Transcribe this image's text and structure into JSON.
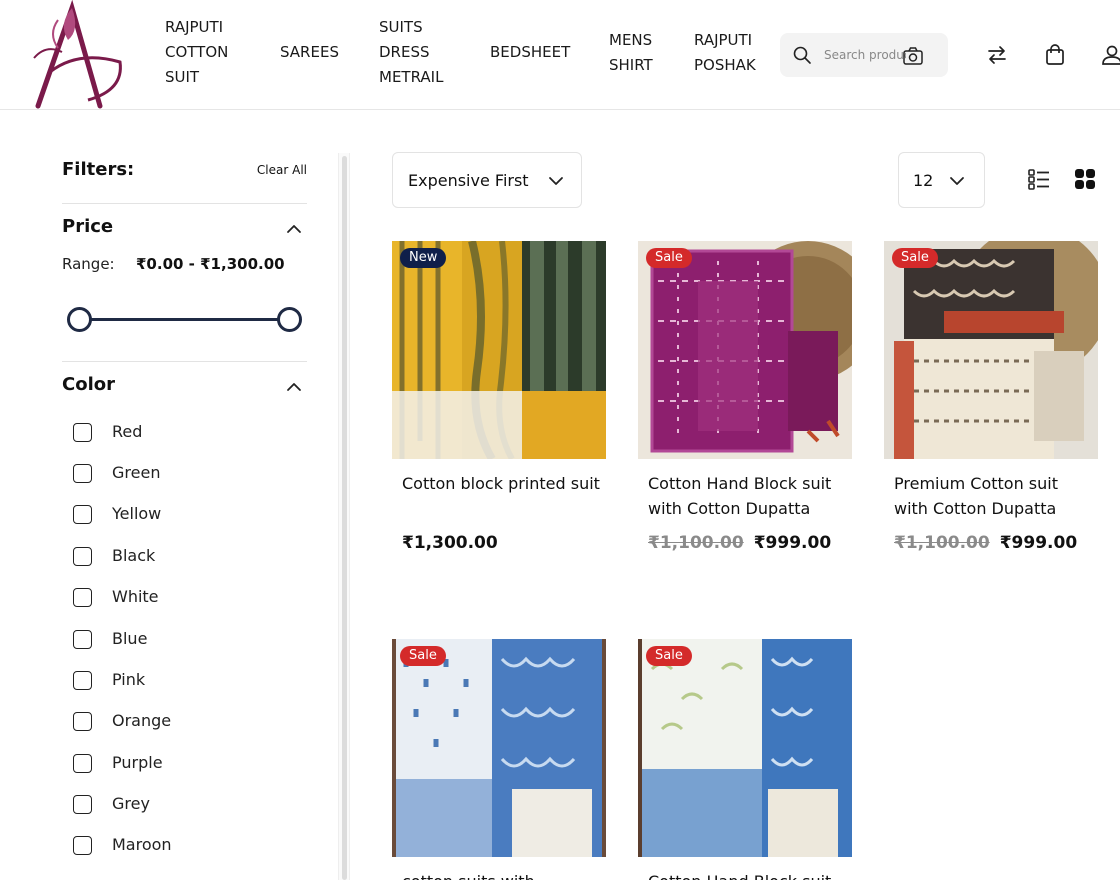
{
  "header": {
    "nav": [
      {
        "label": "RAJPUTI COTTON SUIT"
      },
      {
        "label": "SAREES"
      },
      {
        "label": "SUITS DRESS METRAIL"
      },
      {
        "label": "BEDSHEET"
      },
      {
        "label": "MENS SHIRT"
      },
      {
        "label": "RAJPUTI POSHAK"
      }
    ],
    "search": {
      "placeholder": "Search products",
      "icon": "search-icon",
      "camera_icon": "camera-icon"
    },
    "icons": [
      "compare-arrows-icon",
      "shopping-bag-icon",
      "user-icon"
    ]
  },
  "filters": {
    "title": "Filters:",
    "clear_all": "Clear All",
    "price": {
      "title": "Price",
      "range_label": "Range:",
      "range_value": "₹0.00 - ₹1,300.00",
      "min": 0,
      "max": 1300
    },
    "color": {
      "title": "Color",
      "options": [
        "Red",
        "Green",
        "Yellow",
        "Black",
        "White",
        "Blue",
        "Pink",
        "Orange",
        "Purple",
        "Grey",
        "Maroon"
      ]
    }
  },
  "toolbar": {
    "sort": "Expensive First",
    "per_page": "12",
    "view_icons": [
      "list-view-icon",
      "grid-view-icon"
    ]
  },
  "products": [
    {
      "badge": "New",
      "name": "Cotton block printed suit",
      "price": "₹1,300.00",
      "old_price": ""
    },
    {
      "badge": "Sale",
      "name": "Cotton Hand Block suit with Cotton Dupatta",
      "price": "₹999.00",
      "old_price": "₹1,100.00"
    },
    {
      "badge": "Sale",
      "name": "Premium Cotton suit with Cotton Dupatta",
      "price": "₹999.00",
      "old_price": "₹1,100.00"
    },
    {
      "badge": "Sale",
      "name": "cotton suits with",
      "price": "",
      "old_price": ""
    },
    {
      "badge": "Sale",
      "name": "Cotton Hand Block suit",
      "price": "",
      "old_price": ""
    }
  ],
  "colors": {
    "brand": "#7a1a4a",
    "sale_badge": "#d42a2a",
    "new_badge": "#0f1f4a",
    "slider": "#1f2a44"
  }
}
